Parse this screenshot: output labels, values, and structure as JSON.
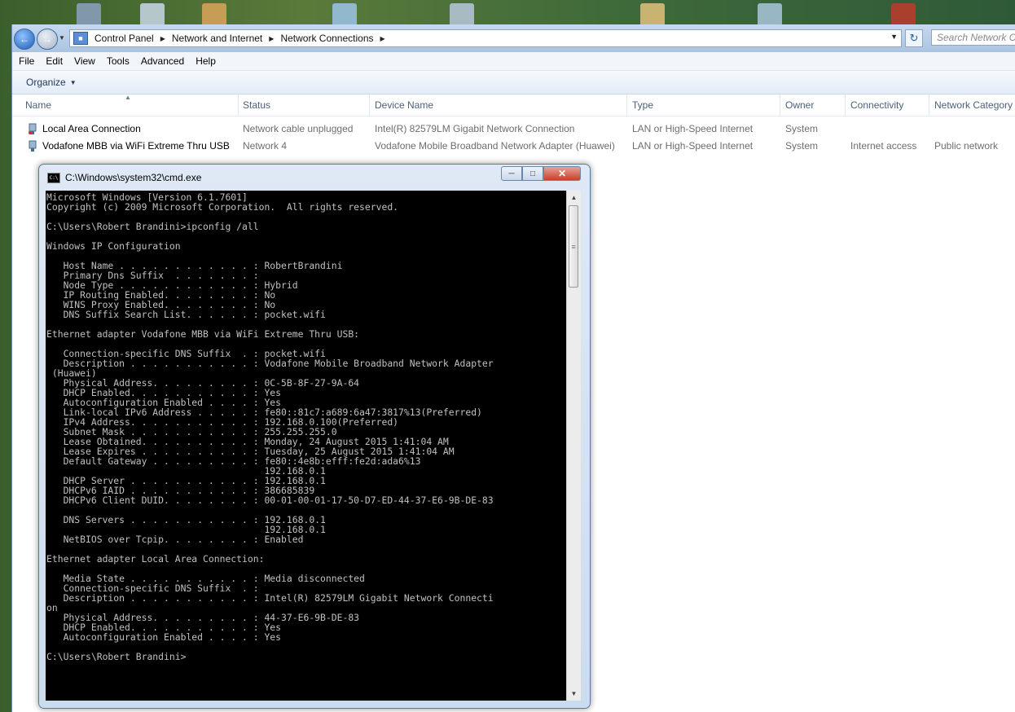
{
  "explorer": {
    "breadcrumb": [
      "Control Panel",
      "Network and Internet",
      "Network Connections"
    ],
    "search_placeholder": "Search Network Co",
    "menu": [
      "File",
      "Edit",
      "View",
      "Tools",
      "Advanced",
      "Help"
    ],
    "organize_label": "Organize",
    "columns": [
      "Name",
      "Status",
      "Device Name",
      "Type",
      "Owner",
      "Connectivity",
      "Network Category"
    ],
    "rows": [
      {
        "name": "Local Area Connection",
        "status": "Network cable unplugged",
        "device": "Intel(R) 82579LM Gigabit Network Connection",
        "type": "LAN or High-Speed Internet",
        "owner": "System",
        "connectivity": "",
        "category": ""
      },
      {
        "name": "Vodafone MBB via WiFi Extreme Thru USB",
        "status": "Network  4",
        "device": "Vodafone Mobile Broadband Network Adapter (Huawei)",
        "type": "LAN or High-Speed Internet",
        "owner": "System",
        "connectivity": "Internet access",
        "category": "Public network"
      }
    ]
  },
  "cmd": {
    "title": "C:\\Windows\\system32\\cmd.exe",
    "output": "Microsoft Windows [Version 6.1.7601]\nCopyright (c) 2009 Microsoft Corporation.  All rights reserved.\n\nC:\\Users\\Robert Brandini>ipconfig /all\n\nWindows IP Configuration\n\n   Host Name . . . . . . . . . . . . : RobertBrandini\n   Primary Dns Suffix  . . . . . . . :\n   Node Type . . . . . . . . . . . . : Hybrid\n   IP Routing Enabled. . . . . . . . : No\n   WINS Proxy Enabled. . . . . . . . : No\n   DNS Suffix Search List. . . . . . : pocket.wifi\n\nEthernet adapter Vodafone MBB via WiFi Extreme Thru USB:\n\n   Connection-specific DNS Suffix  . : pocket.wifi\n   Description . . . . . . . . . . . : Vodafone Mobile Broadband Network Adapter\n (Huawei)\n   Physical Address. . . . . . . . . : 0C-5B-8F-27-9A-64\n   DHCP Enabled. . . . . . . . . . . : Yes\n   Autoconfiguration Enabled . . . . : Yes\n   Link-local IPv6 Address . . . . . : fe80::81c7:a689:6a47:3817%13(Preferred)\n   IPv4 Address. . . . . . . . . . . : 192.168.0.100(Preferred)\n   Subnet Mask . . . . . . . . . . . : 255.255.255.0\n   Lease Obtained. . . . . . . . . . : Monday, 24 August 2015 1:41:04 AM\n   Lease Expires . . . . . . . . . . : Tuesday, 25 August 2015 1:41:04 AM\n   Default Gateway . . . . . . . . . : fe80::4e8b:efff:fe2d:ada6%13\n                                       192.168.0.1\n   DHCP Server . . . . . . . . . . . : 192.168.0.1\n   DHCPv6 IAID . . . . . . . . . . . : 386685839\n   DHCPv6 Client DUID. . . . . . . . : 00-01-00-01-17-50-D7-ED-44-37-E6-9B-DE-83\n\n   DNS Servers . . . . . . . . . . . : 192.168.0.1\n                                       192.168.0.1\n   NetBIOS over Tcpip. . . . . . . . : Enabled\n\nEthernet adapter Local Area Connection:\n\n   Media State . . . . . . . . . . . : Media disconnected\n   Connection-specific DNS Suffix  . :\n   Description . . . . . . . . . . . : Intel(R) 82579LM Gigabit Network Connecti\non\n   Physical Address. . . . . . . . . : 44-37-E6-9B-DE-83\n   DHCP Enabled. . . . . . . . . . . : Yes\n   Autoconfiguration Enabled . . . . : Yes\n\nC:\\Users\\Robert Brandini>"
  },
  "colors": {
    "console_bg": "#000000",
    "console_text": "#c0c0c0",
    "accent": "#1e5bb5"
  }
}
